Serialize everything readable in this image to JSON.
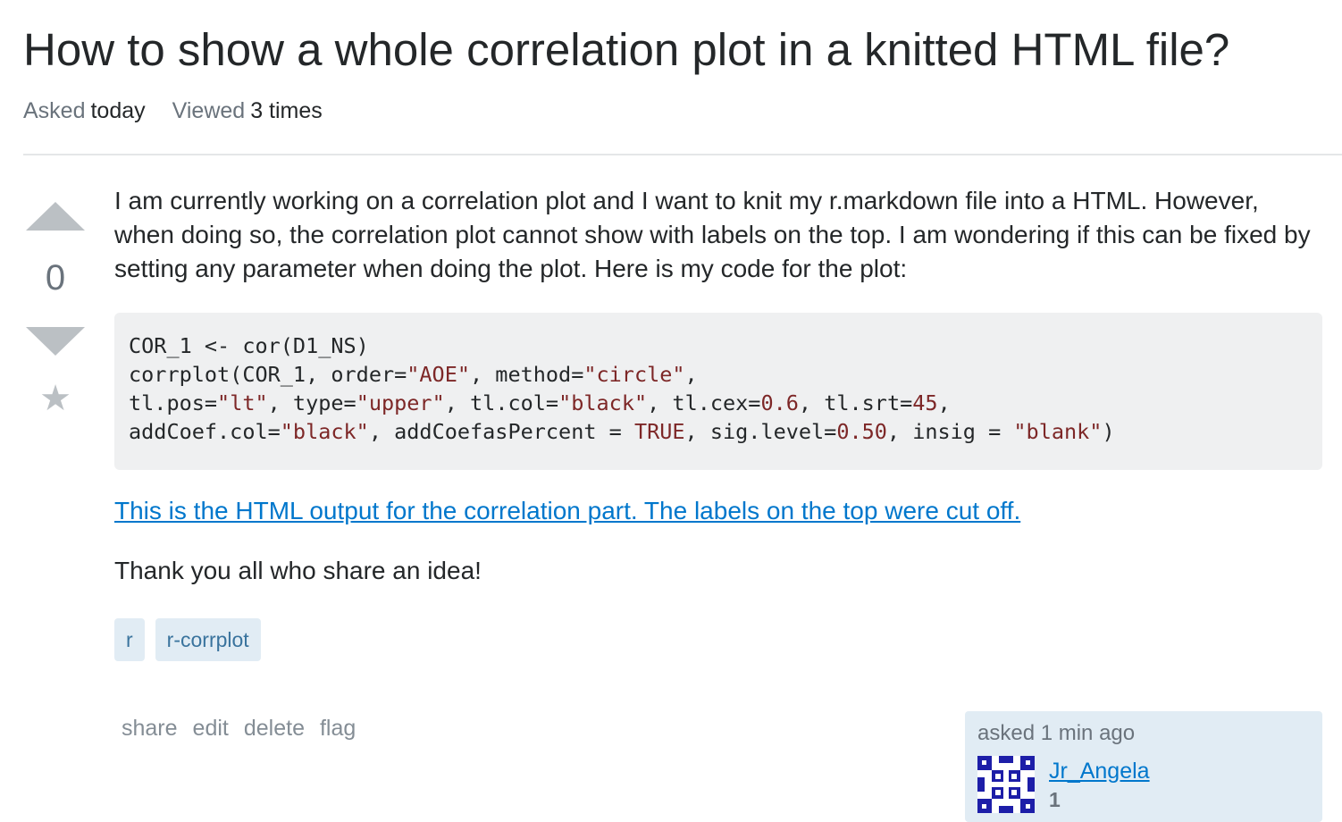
{
  "question": {
    "title": "How to show a whole correlation plot in a knitted HTML file?",
    "meta": {
      "asked_label": "Asked",
      "asked_value": "today",
      "viewed_label": "Viewed",
      "viewed_value": "3 times"
    },
    "vote_count": "0",
    "body_text": "I am currently working on a correlation plot and I want to knit my r.markdown file into a HTML. However, when doing so, the correlation plot cannot show with labels on the top. I am wondering if this can be fixed by setting any parameter when doing the plot. Here is my code for the plot:",
    "code": {
      "line1": "COR_1 <- cor(D1_NS)",
      "l2_a": "corrplot(COR_1, order=",
      "l2_b": "\"AOE\"",
      "l2_c": ", method=",
      "l2_d": "\"circle\"",
      "l2_e": ",",
      "l3_a": "tl.pos=",
      "l3_b": "\"lt\"",
      "l3_c": ", type=",
      "l3_d": "\"upper\"",
      "l3_e": ", tl.col=",
      "l3_f": "\"black\"",
      "l3_g": ", tl.cex=",
      "l3_h": "0.6",
      "l3_i": ", tl.srt=",
      "l3_j": "45",
      "l3_k": ",",
      "l4_a": "addCoef.col=",
      "l4_b": "\"black\"",
      "l4_c": ", addCoefasPercent = ",
      "l4_d": "TRUE",
      "l4_e": ", sig.level=",
      "l4_f": "0.50",
      "l4_g": ", insig = ",
      "l4_h": "\"blank\"",
      "l4_i": ")"
    },
    "link_text": "This is the HTML output for the correlation part. The labels on the top were cut off.",
    "closing_text": "Thank you all who share an idea!",
    "tags": [
      "r",
      "r-corrplot"
    ],
    "actions": {
      "share": "share",
      "edit": "edit",
      "delete": "delete",
      "flag": "flag"
    },
    "owner": {
      "asked_time": "asked 1 min ago",
      "name": "Jr_Angela",
      "reputation": "1"
    }
  },
  "colors": {
    "link": "#0077cc",
    "tag_bg": "#e1ecf4",
    "tag_text": "#39739d",
    "code_bg": "#eff0f1",
    "code_literal": "#7d2727",
    "vote_arrow": "#bbc0c4",
    "avatar_dark": "#1d1ea8",
    "avatar_light": "#ffffff"
  },
  "icons": {
    "vote_up": "triangle-up-icon",
    "vote_down": "triangle-down-icon",
    "favorite": "star-icon",
    "avatar": "identicon-avatar"
  }
}
